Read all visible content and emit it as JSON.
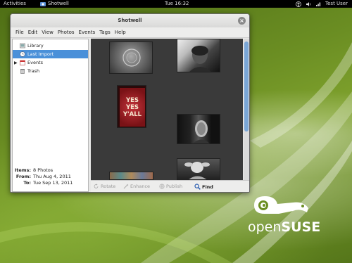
{
  "topbar": {
    "activities": "Activities",
    "app_name": "Shotwell",
    "clock": "Tue 16:32",
    "user": "Test User"
  },
  "window": {
    "title": "Shotwell",
    "close": "×"
  },
  "menu": [
    "File",
    "Edit",
    "View",
    "Photos",
    "Events",
    "Tags",
    "Help"
  ],
  "sidebar": {
    "items": [
      {
        "label": "Library",
        "icon": "library-icon"
      },
      {
        "label": "Last Import",
        "icon": "import-icon",
        "selected": true
      },
      {
        "label": "Events",
        "icon": "events-icon",
        "expander": "▶"
      },
      {
        "label": "Trash",
        "icon": "trash-icon"
      }
    ]
  },
  "info": {
    "items_label": "Items:",
    "items_value": "8 Photos",
    "from_label": "From:",
    "from_value": "Thu Aug 4, 2011",
    "to_label": "To:",
    "to_value": "Tue Sep 13, 2011"
  },
  "photos": [
    {
      "kind": "stamp",
      "caption": ""
    },
    {
      "kind": "portrait-man",
      "caption": ""
    },
    {
      "kind": "yes-sign",
      "caption": "YES YES Y'ALL"
    },
    {
      "kind": "portrait-dark",
      "caption": ""
    },
    {
      "kind": "colorful",
      "caption": ""
    },
    {
      "kind": "statue",
      "caption": ""
    }
  ],
  "toolbar": {
    "rotate": "Rotate",
    "enhance": "Enhance",
    "publish": "Publish",
    "find": "Find"
  },
  "desktop": {
    "logo_open": "open",
    "logo_suse": "SUSE",
    "accent": "#6b8e23"
  }
}
